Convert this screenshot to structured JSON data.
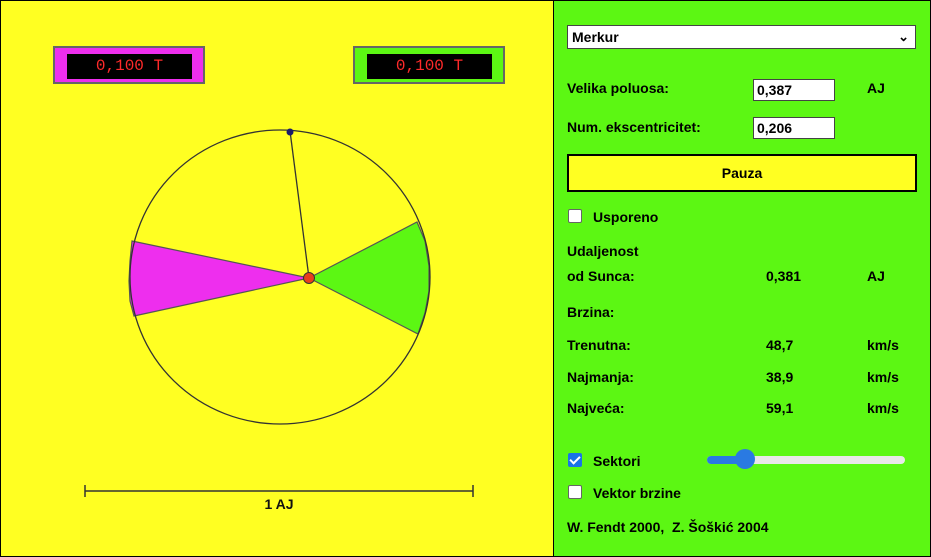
{
  "timers": {
    "left": "0,100 T",
    "right": "0,100 T"
  },
  "scale_label": "1 AJ",
  "controls": {
    "planet": "Merkur",
    "semi_major_label": "Velika poluosa:",
    "semi_major_value": "0,387",
    "semi_major_unit": "AJ",
    "eccentricity_label": "Num. ekscentricitet:",
    "eccentricity_value": "0,206",
    "pause_label": "Pauza",
    "slow_label": "Usporeno",
    "slow_checked": false,
    "distance_label_1": "Udaljenost",
    "distance_label_2": "od Sunca:",
    "distance_value": "0,381",
    "distance_unit": "AJ",
    "speed_heading": "Brzina:",
    "current_label": "Trenutna:",
    "current_value": "48,7",
    "current_unit": "km/s",
    "min_label": "Najmanja:",
    "min_value": "38,9",
    "min_unit": "km/s",
    "max_label": "Najveća:",
    "max_value": "59,1",
    "max_unit": "km/s",
    "sectors_label": "Sektori",
    "sectors_checked": true,
    "sectors_slider_value": 0.19,
    "velocity_label": "Vektor brzine",
    "velocity_checked": false,
    "credits": "W. Fendt 2000,  Z. Šoškić 2004"
  },
  "colors": {
    "panel_yellow": "#ffff22",
    "panel_green": "#5cf713",
    "sector_magenta": "#ee2eee",
    "sector_green": "#5cf713",
    "sun": "#e8401c",
    "planet": "#1a1a6a",
    "timer_text": "#ff2a2a"
  }
}
